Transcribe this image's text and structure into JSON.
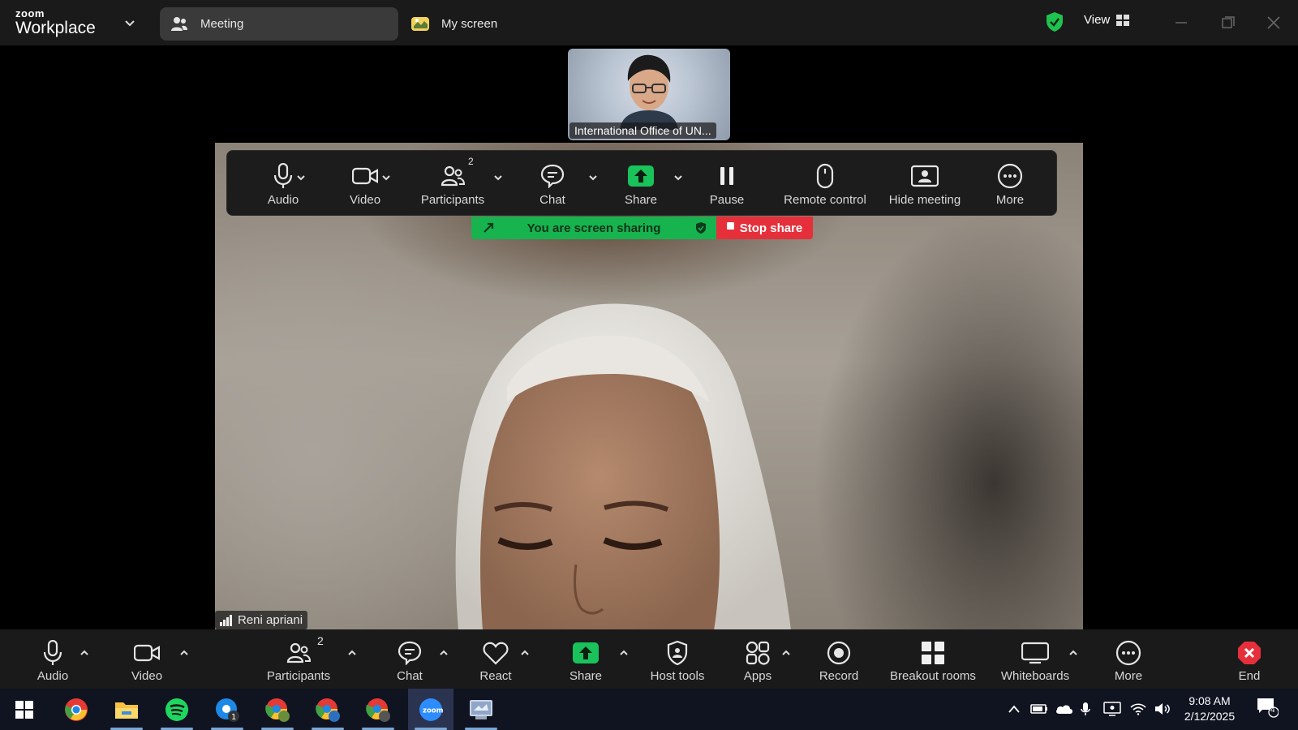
{
  "titlebar": {
    "brand_small": "zoom",
    "brand_big": "Workplace",
    "tabs": [
      {
        "label": "Meeting",
        "icon": "people-icon"
      },
      {
        "label": "My screen",
        "icon": "screen-share-icon"
      }
    ],
    "view_label": "View",
    "shield_color": "#1fc24e"
  },
  "stage": {
    "thumbnail_label": "International Office of UN...",
    "main_participant": "Reni apriani"
  },
  "share_toolbar": {
    "items": [
      {
        "label": "Audio",
        "icon": "microphone-icon"
      },
      {
        "label": "Video",
        "icon": "camera-icon"
      },
      {
        "label": "Participants",
        "icon": "participants-icon",
        "count": "2"
      },
      {
        "label": "Chat",
        "icon": "chat-icon"
      },
      {
        "label": "Share",
        "icon": "share-icon"
      },
      {
        "label": "Pause",
        "icon": "pause-icon"
      },
      {
        "label": "Remote control",
        "icon": "mouse-icon"
      },
      {
        "label": "Hide meeting",
        "icon": "hide-meeting-icon"
      },
      {
        "label": "More",
        "icon": "more-icon"
      }
    ],
    "banner_text": "You are screen sharing",
    "stop_share_label": "Stop share"
  },
  "bottom_toolbar": {
    "items": [
      {
        "label": "Audio",
        "icon": "microphone-icon"
      },
      {
        "label": "Video",
        "icon": "camera-icon"
      },
      {
        "label": "Participants",
        "icon": "participants-icon",
        "count": "2"
      },
      {
        "label": "Chat",
        "icon": "chat-icon"
      },
      {
        "label": "React",
        "icon": "heart-icon"
      },
      {
        "label": "Share",
        "icon": "share-icon"
      },
      {
        "label": "Host tools",
        "icon": "shield-icon"
      },
      {
        "label": "Apps",
        "icon": "apps-icon"
      },
      {
        "label": "Record",
        "icon": "record-icon"
      },
      {
        "label": "Breakout rooms",
        "icon": "breakout-rooms-icon"
      },
      {
        "label": "Whiteboards",
        "icon": "whiteboard-icon"
      },
      {
        "label": "More",
        "icon": "more-icon"
      },
      {
        "label": "End",
        "icon": "end-icon"
      }
    ]
  },
  "taskbar": {
    "time": "9:08 AM",
    "date": "2/12/2025",
    "notification_count": "4",
    "apps": [
      "windows-start-icon",
      "chrome-icon",
      "file-explorer-icon",
      "spotify-icon",
      "chrome-profile-icon",
      "chrome-profile-icon",
      "chrome-profile-icon",
      "chrome-profile-icon",
      "zoom-icon",
      "snipping-tool-icon"
    ]
  },
  "colors": {
    "accent_green": "#17b34e",
    "stop_red": "#e5303b",
    "end_red": "#e5303b",
    "toolbar_bg": "#1c1c1c"
  }
}
